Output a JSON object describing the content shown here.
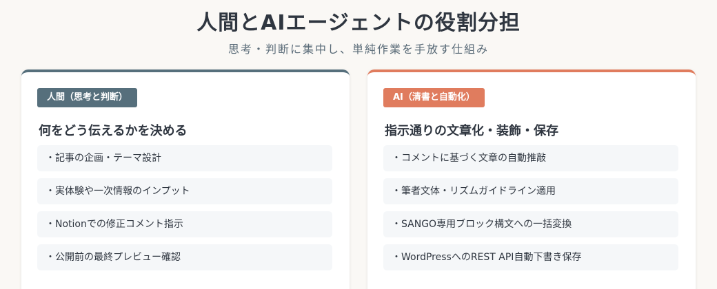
{
  "header": {
    "title": "人間とAIエージェントの役割分担",
    "subtitle": "思考・判断に集中し、単純作業を手放す仕組み"
  },
  "colors": {
    "human_accent": "#566f7c",
    "ai_accent": "#e07c5e"
  },
  "cards": [
    {
      "badge": "人間（思考と判断）",
      "heading": "何をどう伝えるかを決める",
      "items": [
        "・記事の企画・テーマ設計",
        "・実体験や一次情報のインプット",
        "・Notionでの修正コメント指示",
        "・公開前の最終プレビュー確認"
      ]
    },
    {
      "badge": "AI（清書と自動化）",
      "heading": "指示通りの文章化・装飾・保存",
      "items": [
        "・コメントに基づく文章の自動推敲",
        "・筆者文体・リズムガイドライン適用",
        "・SANGO専用ブロック構文への一括変換",
        "・WordPressへのREST API自動下書き保存"
      ]
    }
  ]
}
